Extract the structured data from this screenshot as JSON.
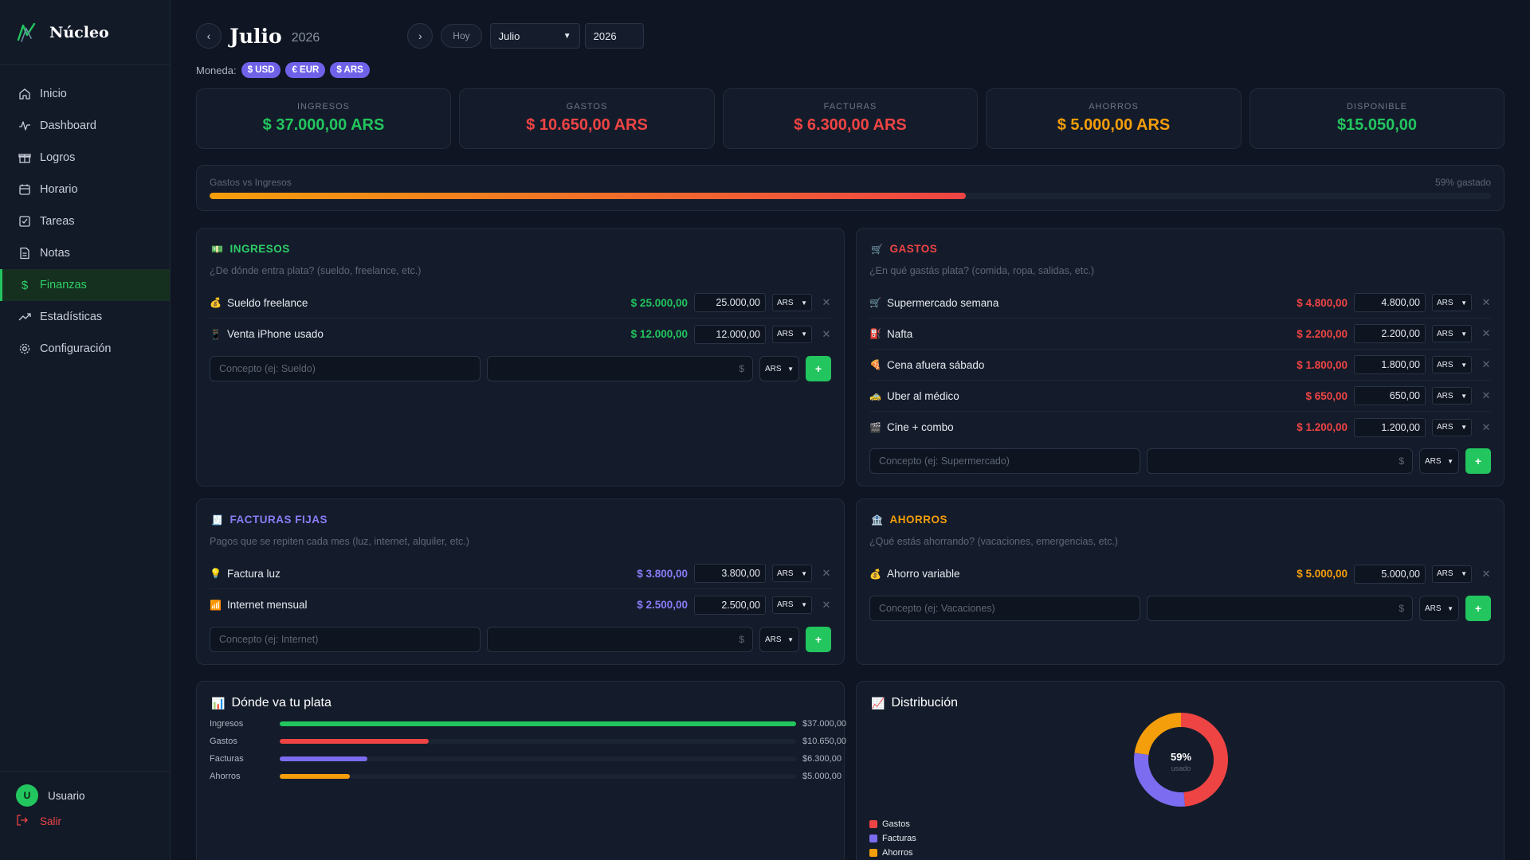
{
  "app": {
    "name": "Núcleo"
  },
  "sidebar": {
    "items": [
      {
        "label": "Inicio",
        "icon": "home-icon"
      },
      {
        "label": "Dashboard",
        "icon": "activity-icon"
      },
      {
        "label": "Logros",
        "icon": "gift-icon"
      },
      {
        "label": "Horario",
        "icon": "calendar-icon"
      },
      {
        "label": "Tareas",
        "icon": "checkbox-icon"
      },
      {
        "label": "Notas",
        "icon": "note-icon"
      },
      {
        "label": "Finanzas",
        "icon": "dollar-icon",
        "active": true
      },
      {
        "label": "Estadísticas",
        "icon": "trend-icon"
      },
      {
        "label": "Configuración",
        "icon": "gear-icon"
      }
    ],
    "user": {
      "initial": "U",
      "name": "Usuario"
    },
    "logout": "Salir"
  },
  "header": {
    "month": "Julio",
    "year": "2026",
    "today_label": "Hoy",
    "month_select": "Julio",
    "year_input": "2026",
    "prev": "‹",
    "next": "›"
  },
  "currency": {
    "label": "Moneda:",
    "options": [
      "$ USD",
      "€ EUR",
      "$ ARS"
    ]
  },
  "stats": [
    {
      "label": "INGRESOS",
      "value": "$ 37.000,00 ARS",
      "color": "#22c55e"
    },
    {
      "label": "GASTOS",
      "value": "$ 10.650,00 ARS",
      "color": "#ef4444"
    },
    {
      "label": "FACTURAS",
      "value": "$ 6.300,00 ARS",
      "color": "#ef4444"
    },
    {
      "label": "AHORROS",
      "value": "$ 5.000,00 ARS",
      "color": "#f59e0b"
    },
    {
      "label": "DISPONIBLE",
      "value": "$15.050,00",
      "color": "#22c55e"
    }
  ],
  "progress": {
    "label": "Gastos vs Ingresos",
    "right": "59% gastado",
    "fraction": 0.59
  },
  "ingresos": {
    "title": "INGRESOS",
    "icon": "💵",
    "subtitle": "¿De dónde entra plata? (sueldo, freelance, etc.)",
    "color": "#2ecf68",
    "rows": [
      {
        "emoji": "💰",
        "name": "Sueldo freelance",
        "amount": "$ 25.000,00",
        "input": "25.000,00",
        "cur": "ARS"
      },
      {
        "emoji": "📱",
        "name": "Venta iPhone usado",
        "amount": "$ 12.000,00",
        "input": "12.000,00",
        "cur": "ARS"
      }
    ],
    "placeholder": "Concepto (ej: Sueldo)",
    "amount_ph": "$",
    "cur": "ARS",
    "add": "+"
  },
  "gastos": {
    "title": "GASTOS",
    "icon": "🛒",
    "subtitle": "¿En qué gastás plata? (comida, ropa, salidas, etc.)",
    "color": "#ef4444",
    "rows": [
      {
        "emoji": "🛒",
        "name": "Supermercado semana",
        "amount": "$ 4.800,00",
        "input": "4.800,00",
        "cur": "ARS"
      },
      {
        "emoji": "⛽",
        "name": "Nafta",
        "amount": "$ 2.200,00",
        "input": "2.200,00",
        "cur": "ARS"
      },
      {
        "emoji": "🍕",
        "name": "Cena afuera sábado",
        "amount": "$ 1.800,00",
        "input": "1.800,00",
        "cur": "ARS"
      },
      {
        "emoji": "🚕",
        "name": "Uber al médico",
        "amount": "$ 650,00",
        "input": "650,00",
        "cur": "ARS"
      },
      {
        "emoji": "🎬",
        "name": "Cine + combo",
        "amount": "$ 1.200,00",
        "input": "1.200,00",
        "cur": "ARS"
      }
    ],
    "placeholder": "Concepto (ej: Supermercado)",
    "amount_ph": "$",
    "cur": "ARS",
    "add": "+"
  },
  "facturas": {
    "title": "FACTURAS FIJAS",
    "icon": "🧾",
    "subtitle": "Pagos que se repiten cada mes (luz, internet, alquiler, etc.)",
    "color": "#8b7cf6",
    "rows": [
      {
        "emoji": "💡",
        "name": "Factura luz",
        "amount": "$ 3.800,00",
        "input": "3.800,00",
        "cur": "ARS"
      },
      {
        "emoji": "📶",
        "name": "Internet mensual",
        "amount": "$ 2.500,00",
        "input": "2.500,00",
        "cur": "ARS"
      }
    ],
    "placeholder": "Concepto (ej: Internet)",
    "amount_ph": "$",
    "cur": "ARS",
    "add": "+"
  },
  "ahorros": {
    "title": "AHORROS",
    "icon": "🏦",
    "subtitle": "¿Qué estás ahorrando? (vacaciones, emergencias, etc.)",
    "color": "#f59e0b",
    "rows": [
      {
        "emoji": "💰",
        "name": "Ahorro variable",
        "amount": "$ 5.000,00",
        "input": "5.000,00",
        "cur": "ARS"
      }
    ],
    "placeholder": "Concepto (ej: Vacaciones)",
    "amount_ph": "$",
    "cur": "ARS",
    "add": "+"
  },
  "donde": {
    "title": "Dónde va tu plata",
    "icon": "📊",
    "bars": [
      {
        "label": "Ingresos",
        "value": 37000,
        "display": "$37.000,00",
        "color": "#22c55e"
      },
      {
        "label": "Gastos",
        "value": 10650,
        "display": "$10.650,00",
        "color": "#ef4444"
      },
      {
        "label": "Facturas",
        "value": 6300,
        "display": "$6.300,00",
        "color": "#7c6cf0"
      },
      {
        "label": "Ahorros",
        "value": 5000,
        "display": "$5.000,00",
        "color": "#f59e0b"
      }
    ],
    "max": 37000
  },
  "chart_data": {
    "type": "pie",
    "title": "Distribución",
    "center_value": "59%",
    "center_label": "usado",
    "labels": [
      "Gastos",
      "Facturas",
      "Ahorros"
    ],
    "values": [
      10650,
      6300,
      5000
    ],
    "colors": [
      "#ef4444",
      "#7c6cf0",
      "#f59e0b"
    ],
    "legend": "bottom-left"
  }
}
